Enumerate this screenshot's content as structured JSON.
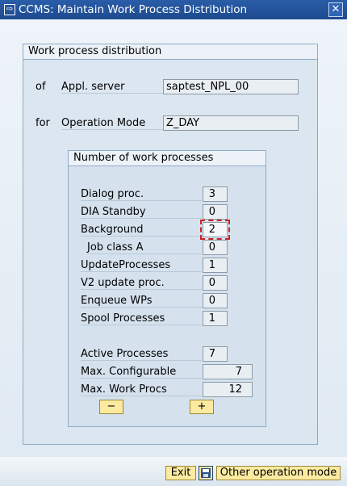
{
  "window": {
    "title": "CCMS: Maintain Work Process Distribution",
    "icon": "app-menu-icon",
    "close_glyph": "✕"
  },
  "outer_group": {
    "title": "Work process distribution",
    "of_prefix": "of",
    "appl_server_label": "Appl. server",
    "appl_server_value": "saptest_NPL_00",
    "for_prefix": "for",
    "operation_mode_label": "Operation Mode",
    "operation_mode_value": "Z_DAY"
  },
  "processes": {
    "title": "Number of work processes",
    "rows": [
      {
        "label": "Dialog proc.",
        "value": "3"
      },
      {
        "label": "DIA Standby",
        "value": "0"
      },
      {
        "label": "Background",
        "value": "2"
      },
      {
        "label": "Job class A",
        "value": "0"
      },
      {
        "label": "UpdateProcesses",
        "value": "1"
      },
      {
        "label": "V2 update proc.",
        "value": "0"
      },
      {
        "label": "Enqueue WPs",
        "value": "0"
      },
      {
        "label": "Spool Processes",
        "value": "1"
      }
    ],
    "summary": [
      {
        "label": "Active Processes",
        "value": "7"
      },
      {
        "label": "Max. Configurable",
        "value": "7"
      },
      {
        "label": "Max. Work Procs",
        "value": "12"
      }
    ],
    "minus_label": "−",
    "plus_label": "+"
  },
  "footer": {
    "exit_label": "Exit",
    "save_icon": "save-icon",
    "other_mode_label": "Other operation mode"
  }
}
